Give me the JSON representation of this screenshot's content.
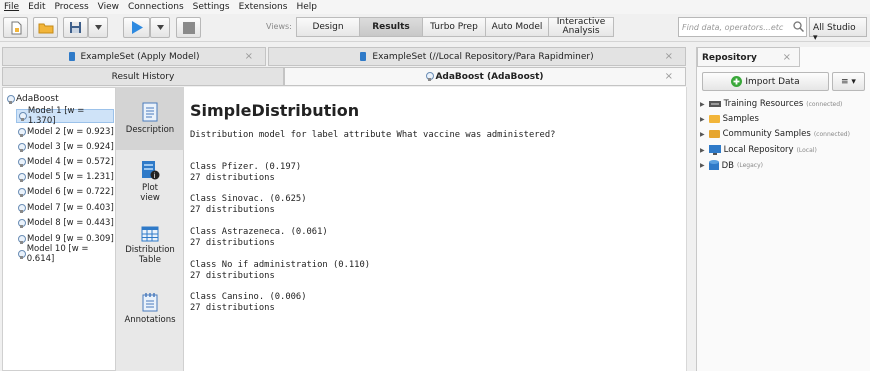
{
  "menu": [
    "File",
    "Edit",
    "Process",
    "View",
    "Connections",
    "Settings",
    "Extensions",
    "Help"
  ],
  "toolbar": {
    "views_label": "Views:",
    "views": [
      {
        "label": "Design",
        "active": false
      },
      {
        "label": "Results",
        "active": true
      },
      {
        "label": "Turbo Prep",
        "active": false
      },
      {
        "label": "Auto Model",
        "active": false
      },
      {
        "label": "Interactive Analysis",
        "active": false
      }
    ],
    "search_placeholder": "Find data, operators...etc",
    "studio": "All Studio ▾"
  },
  "tabs_top": [
    {
      "label": "ExampleSet (Apply Model)"
    },
    {
      "label": "ExampleSet (//Local Repository/Para Rapidminer)"
    }
  ],
  "tabs_second": [
    {
      "label": "Result History",
      "selected": false
    },
    {
      "label": "AdaBoost (AdaBoost)",
      "selected": true
    }
  ],
  "tree": {
    "root": "AdaBoost",
    "items": [
      "Model 1 [w = 1.370]",
      "Model 2 [w = 0.923]",
      "Model 3 [w = 0.924]",
      "Model 4 [w = 0.572]",
      "Model 5 [w = 1.231]",
      "Model 6 [w = 0.722]",
      "Model 7 [w = 0.403]",
      "Model 8 [w = 0.443]",
      "Model 9 [w = 0.309]",
      "Model 10 [w = 0.614]"
    ],
    "selected_index": 0
  },
  "sidebar": [
    {
      "label": "Description",
      "icon": "description-icon"
    },
    {
      "label": "Plot view",
      "icon": "plot-view-icon"
    },
    {
      "label": "Distribution Table",
      "icon": "table-icon"
    },
    {
      "label": "Annotations",
      "icon": "annotations-icon"
    }
  ],
  "content": {
    "title": "SimpleDistribution",
    "subtitle": "Distribution model for label attribute What vaccine was administered?",
    "classes": [
      {
        "name": "Class Pfizer. (0.197)",
        "count": "27 distributions"
      },
      {
        "name": "Class Sinovac. (0.625)",
        "count": "27 distributions"
      },
      {
        "name": "Class Astrazeneca. (0.061)",
        "count": "27 distributions"
      },
      {
        "name": "Class No if administration (0.110)",
        "count": "27 distributions"
      },
      {
        "name": "Class Cansino. (0.006)",
        "count": "27 distributions"
      }
    ]
  },
  "repository": {
    "tab": "Repository",
    "import_label": "Import Data",
    "menu_label": "≡ ▾",
    "items": [
      {
        "label": "Training Resources",
        "note": "(connected)"
      },
      {
        "label": "Samples",
        "note": ""
      },
      {
        "label": "Community Samples",
        "note": "(connected)"
      },
      {
        "label": "Local Repository",
        "note": "(Local)"
      },
      {
        "label": "DB",
        "note": "(Legacy)"
      }
    ]
  }
}
